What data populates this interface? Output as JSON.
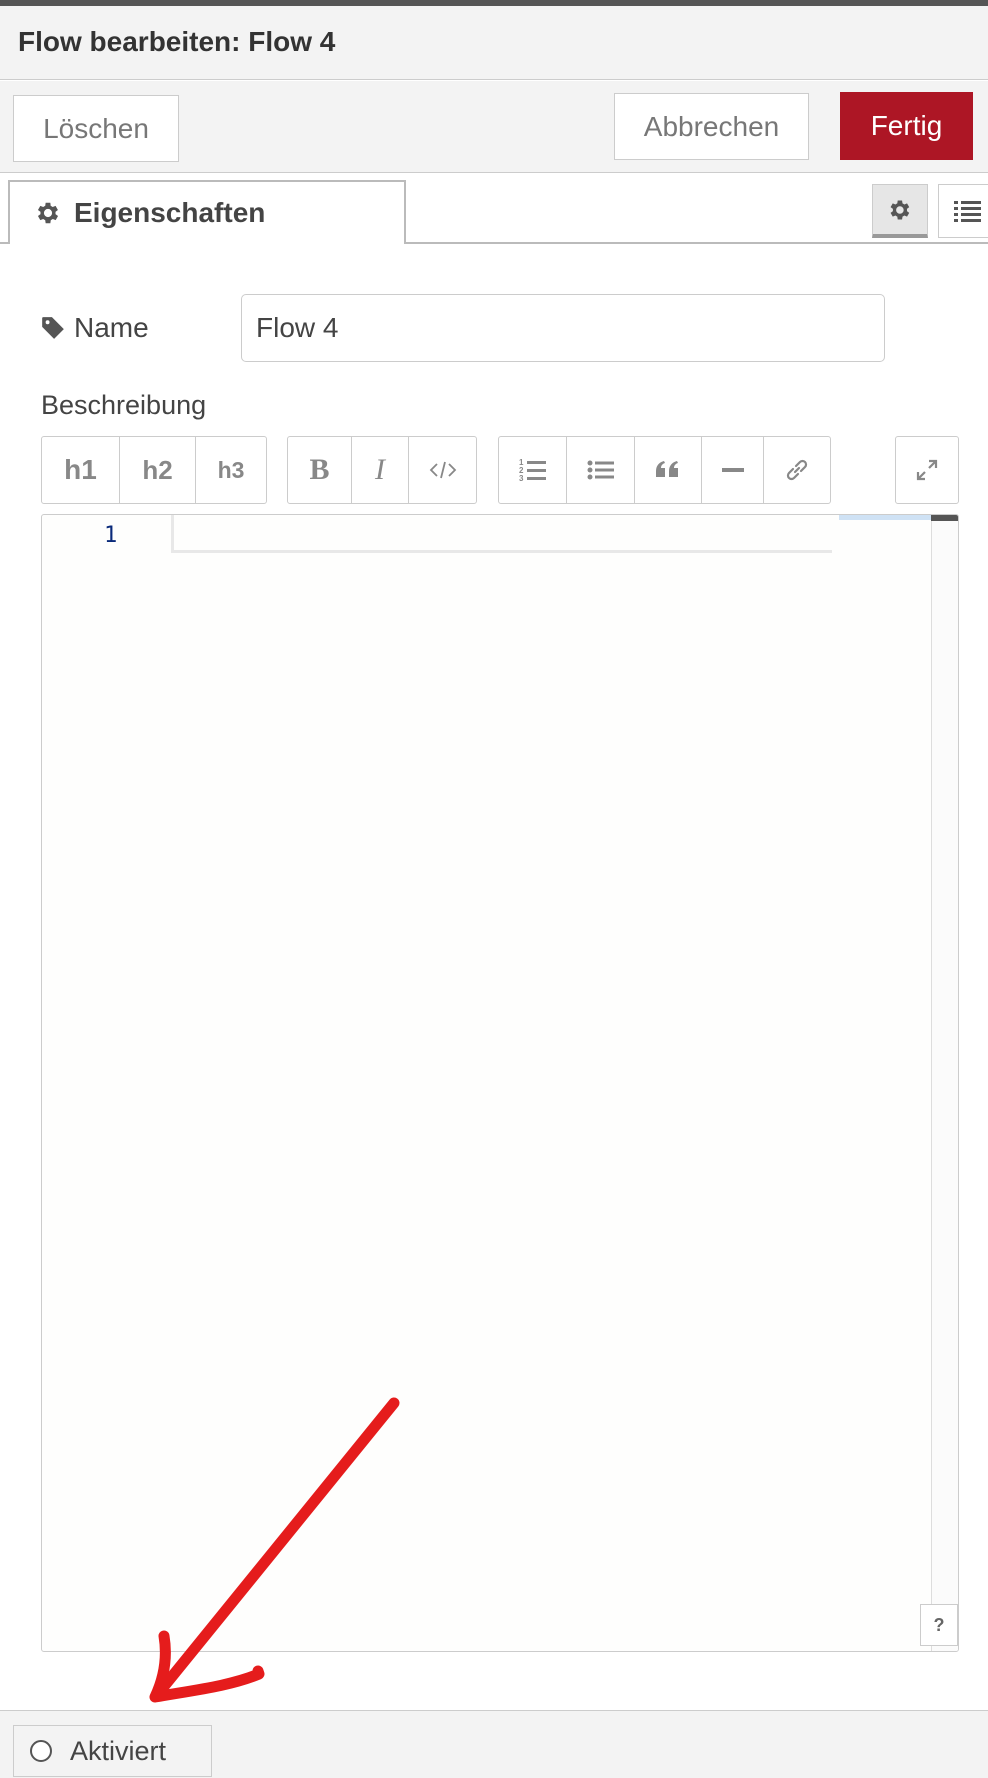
{
  "dialog": {
    "title": "Flow bearbeiten: Flow 4"
  },
  "buttons": {
    "delete": "Löschen",
    "cancel": "Abbrechen",
    "done": "Fertig"
  },
  "tabs": {
    "properties": "Eigenschaften"
  },
  "form": {
    "name_label": "Name",
    "name_value": "Flow 4",
    "description_label": "Beschreibung"
  },
  "toolbar": {
    "h1": "h1",
    "h2": "h2",
    "h3": "h3",
    "bold": "B",
    "italic": "I"
  },
  "editor": {
    "line_number": "1",
    "help": "?"
  },
  "footer": {
    "toggle_label": "Aktiviert"
  },
  "colors": {
    "primary": "#ad1625",
    "annotation": "#e51c1c"
  }
}
